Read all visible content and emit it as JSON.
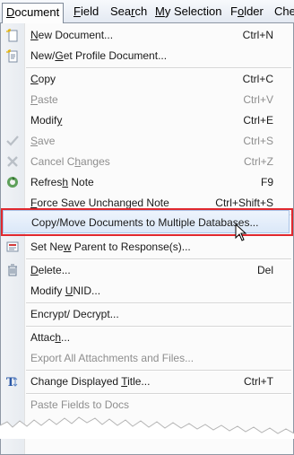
{
  "menubar": {
    "items": [
      {
        "label": "Document",
        "ul": "D",
        "rest": "ocument"
      },
      {
        "label": "Field",
        "ul": "F",
        "rest": "ield"
      },
      {
        "label": "Search",
        "pre": "Sea",
        "ul": "r",
        "post": "ch"
      },
      {
        "label": "My Selection",
        "ul": "M",
        "rest": "y Selection"
      },
      {
        "label": "Folder",
        "pre": "F",
        "ul": "o",
        "post": "lder"
      },
      {
        "label": "Che",
        "pre": "Che",
        "ul": "",
        "post": ""
      }
    ]
  },
  "menu": {
    "items": [
      {
        "pre": "",
        "ul": "N",
        "post": "ew Document...",
        "shortcut": "Ctrl+N"
      },
      {
        "pre": "New/",
        "ul": "G",
        "post": "et Profile Document...",
        "shortcut": ""
      },
      {
        "pre": "",
        "ul": "C",
        "post": "opy",
        "shortcut": "Ctrl+C"
      },
      {
        "pre": "",
        "ul": "P",
        "post": "aste",
        "shortcut": "Ctrl+V"
      },
      {
        "pre": "Modif",
        "ul": "y",
        "post": "",
        "shortcut": "Ctrl+E"
      },
      {
        "pre": "",
        "ul": "S",
        "post": "ave",
        "shortcut": "Ctrl+S"
      },
      {
        "pre": "Cancel C",
        "ul": "h",
        "post": "anges",
        "shortcut": "Ctrl+Z"
      },
      {
        "pre": "Refres",
        "ul": "h",
        "post": " Note",
        "shortcut": "F9"
      },
      {
        "pre": "",
        "ul": "F",
        "post": "orce Save Unchanged Note",
        "shortcut": "Ctrl+Shift+S"
      },
      {
        "pre": "Copy/Move Documents to Multiple Databases...",
        "ul": "",
        "post": "",
        "shortcut": ""
      },
      {
        "pre": "Set Ne",
        "ul": "w",
        "post": " Parent to Response(s)...",
        "shortcut": ""
      },
      {
        "pre": "",
        "ul": "D",
        "post": "elete...",
        "shortcut": "Del"
      },
      {
        "pre": "Modify ",
        "ul": "U",
        "post": "NID...",
        "shortcut": ""
      },
      {
        "pre": "Encrypt/ Decrypt...",
        "ul": "",
        "post": "",
        "shortcut": ""
      },
      {
        "pre": "Attac",
        "ul": "h",
        "post": "...",
        "shortcut": ""
      },
      {
        "pre": "Export All Attachments and Files...",
        "ul": "",
        "post": "",
        "shortcut": ""
      },
      {
        "pre": "Change Displayed ",
        "ul": "T",
        "post": "itle...",
        "shortcut": "Ctrl+T"
      },
      {
        "pre": "Paste Fields to Docs",
        "ul": "",
        "post": "",
        "shortcut": ""
      }
    ]
  },
  "colors": {
    "highlight_border": "#a9c4e8",
    "callout": "#e0282e",
    "disabled_text": "#8e8e8e"
  }
}
